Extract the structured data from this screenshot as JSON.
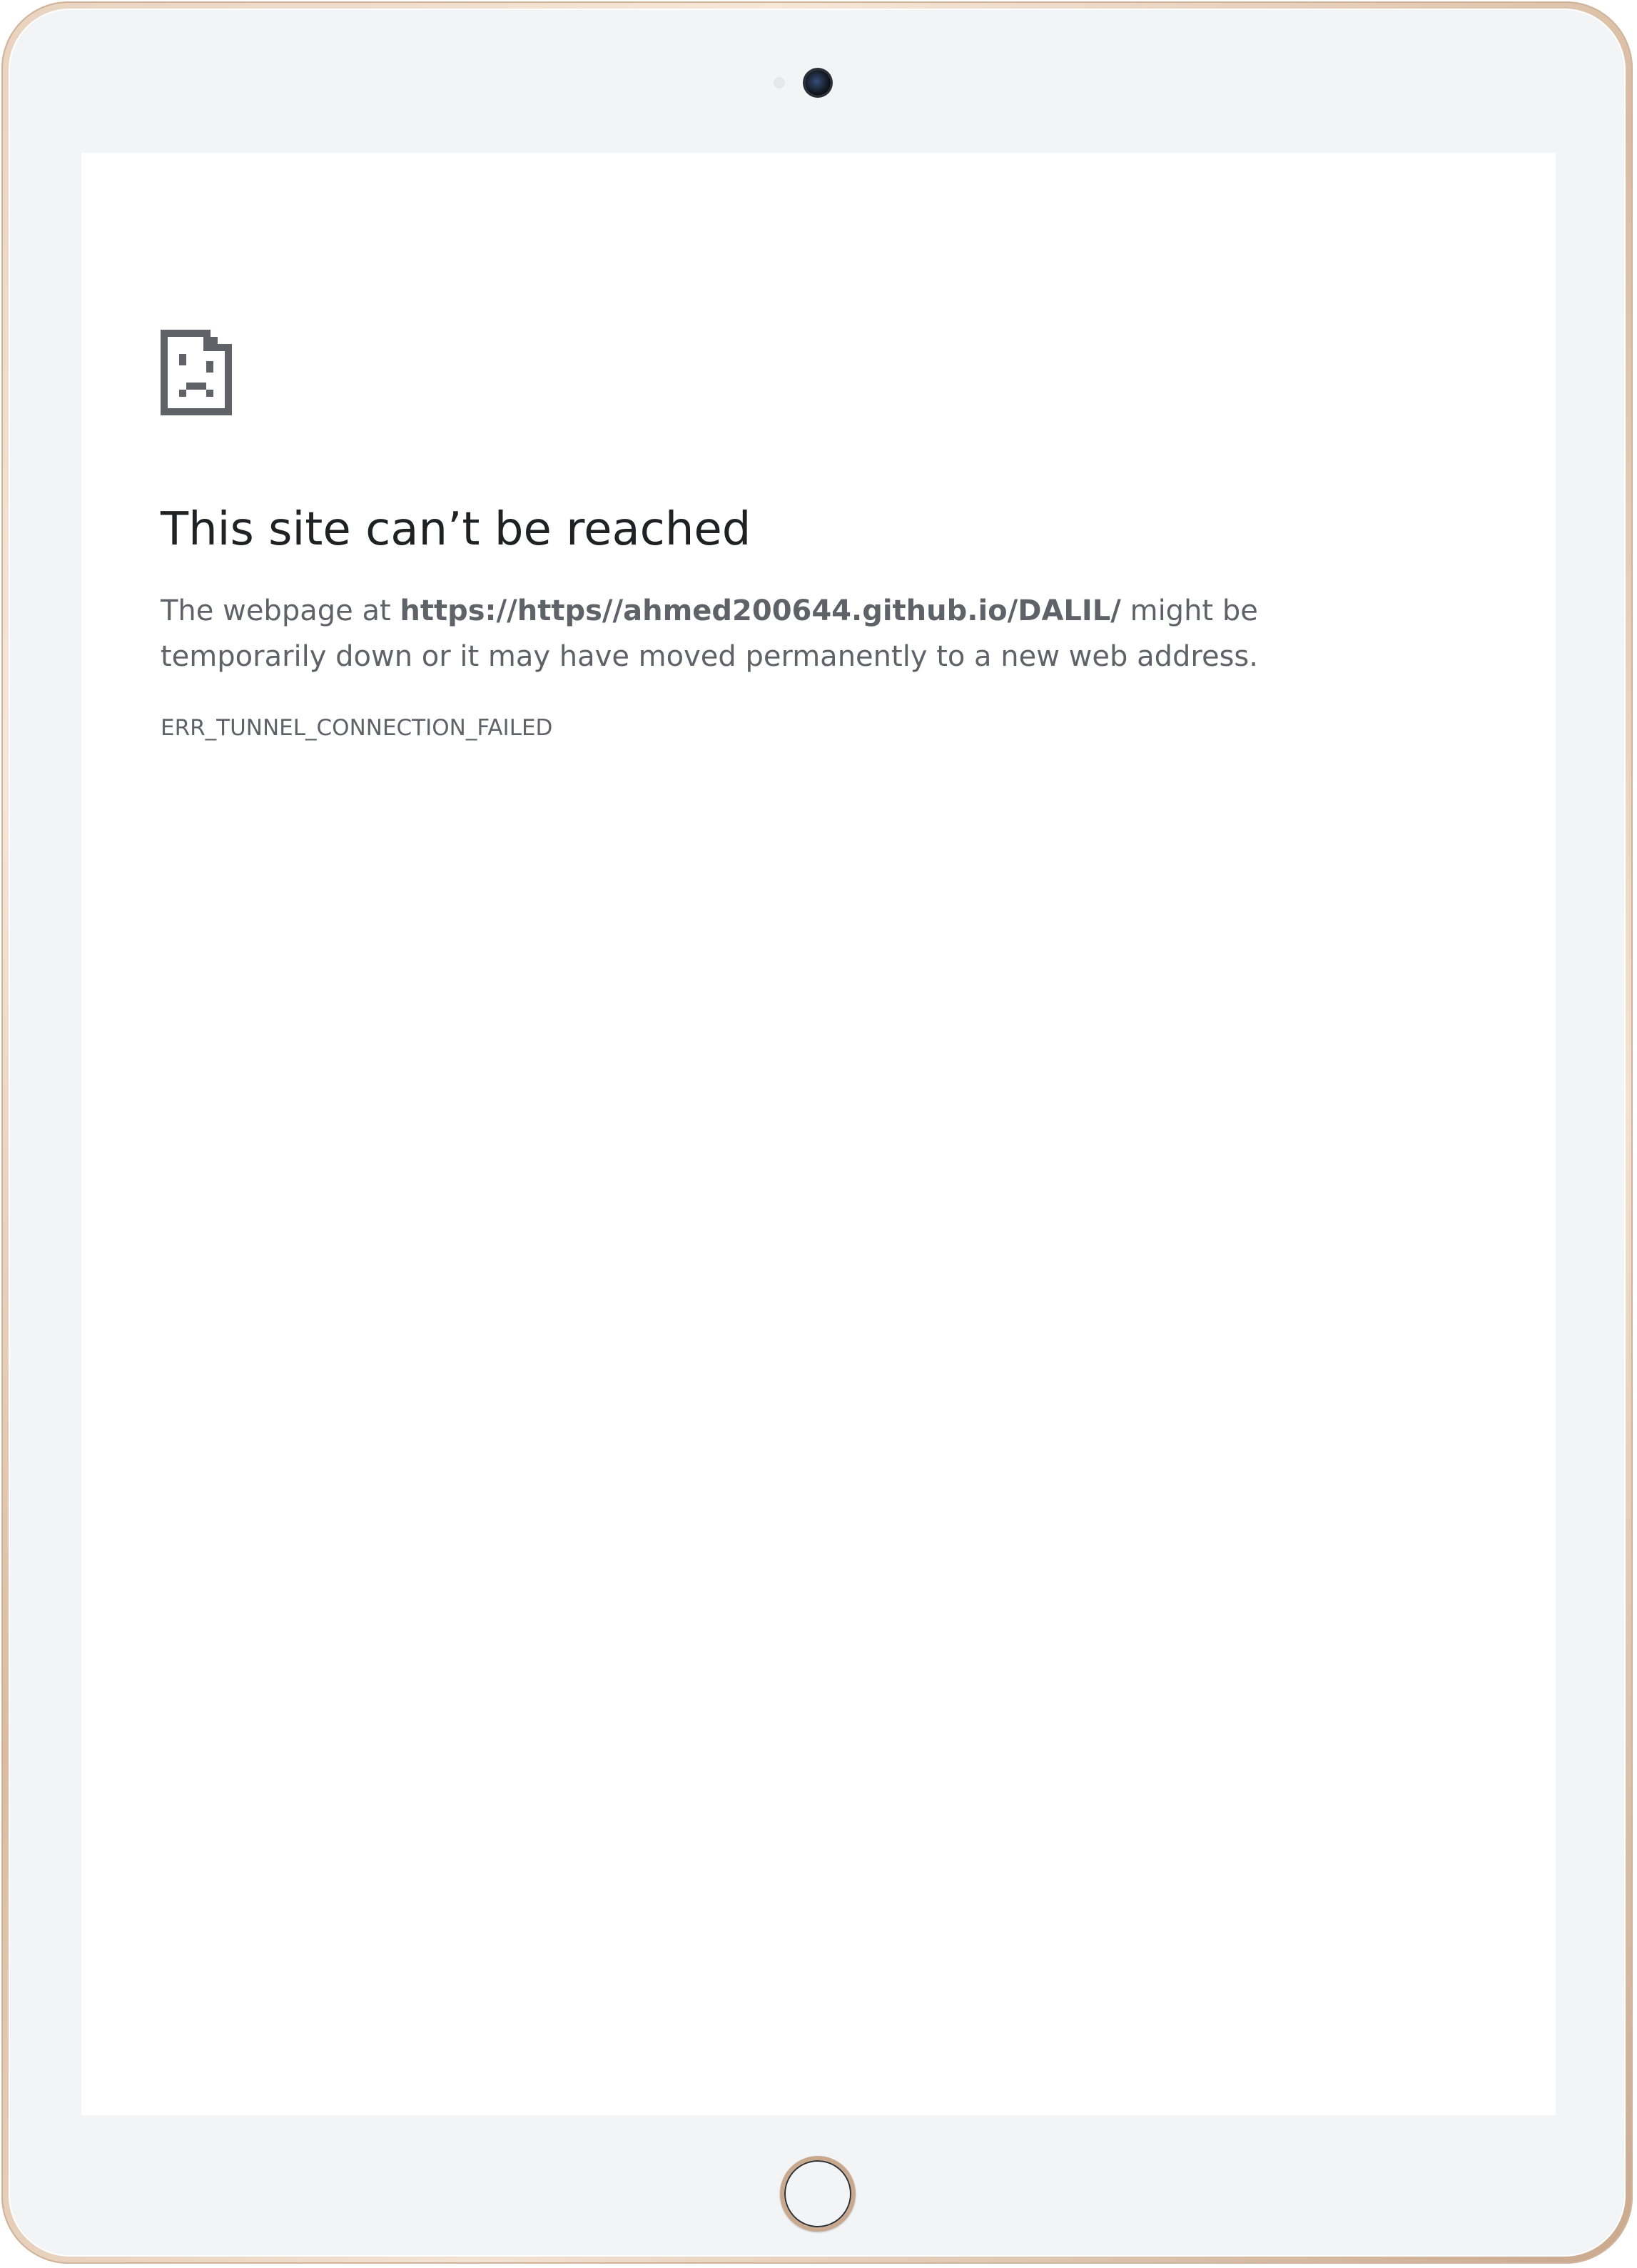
{
  "device": {
    "frame_color": "#e9d3bf",
    "bezel_color": "#f3f4f6",
    "screen_background": "#ffffff",
    "camera_icon": "camera-icon",
    "home_button_icon": "home-button"
  },
  "error_page": {
    "icon": "sad-page-icon",
    "title": "This site can’t be reached",
    "description_prefix": "The webpage at ",
    "url": "https://https//ahmed200644.github.io/DALIL/",
    "description_suffix": " might be temporarily down or it may have moved permanently to a new web address.",
    "error_code": "ERR_TUNNEL_CONNECTION_FAILED",
    "colors": {
      "title": "#202124",
      "text": "#5f6368",
      "icon": "#5f6368"
    }
  }
}
